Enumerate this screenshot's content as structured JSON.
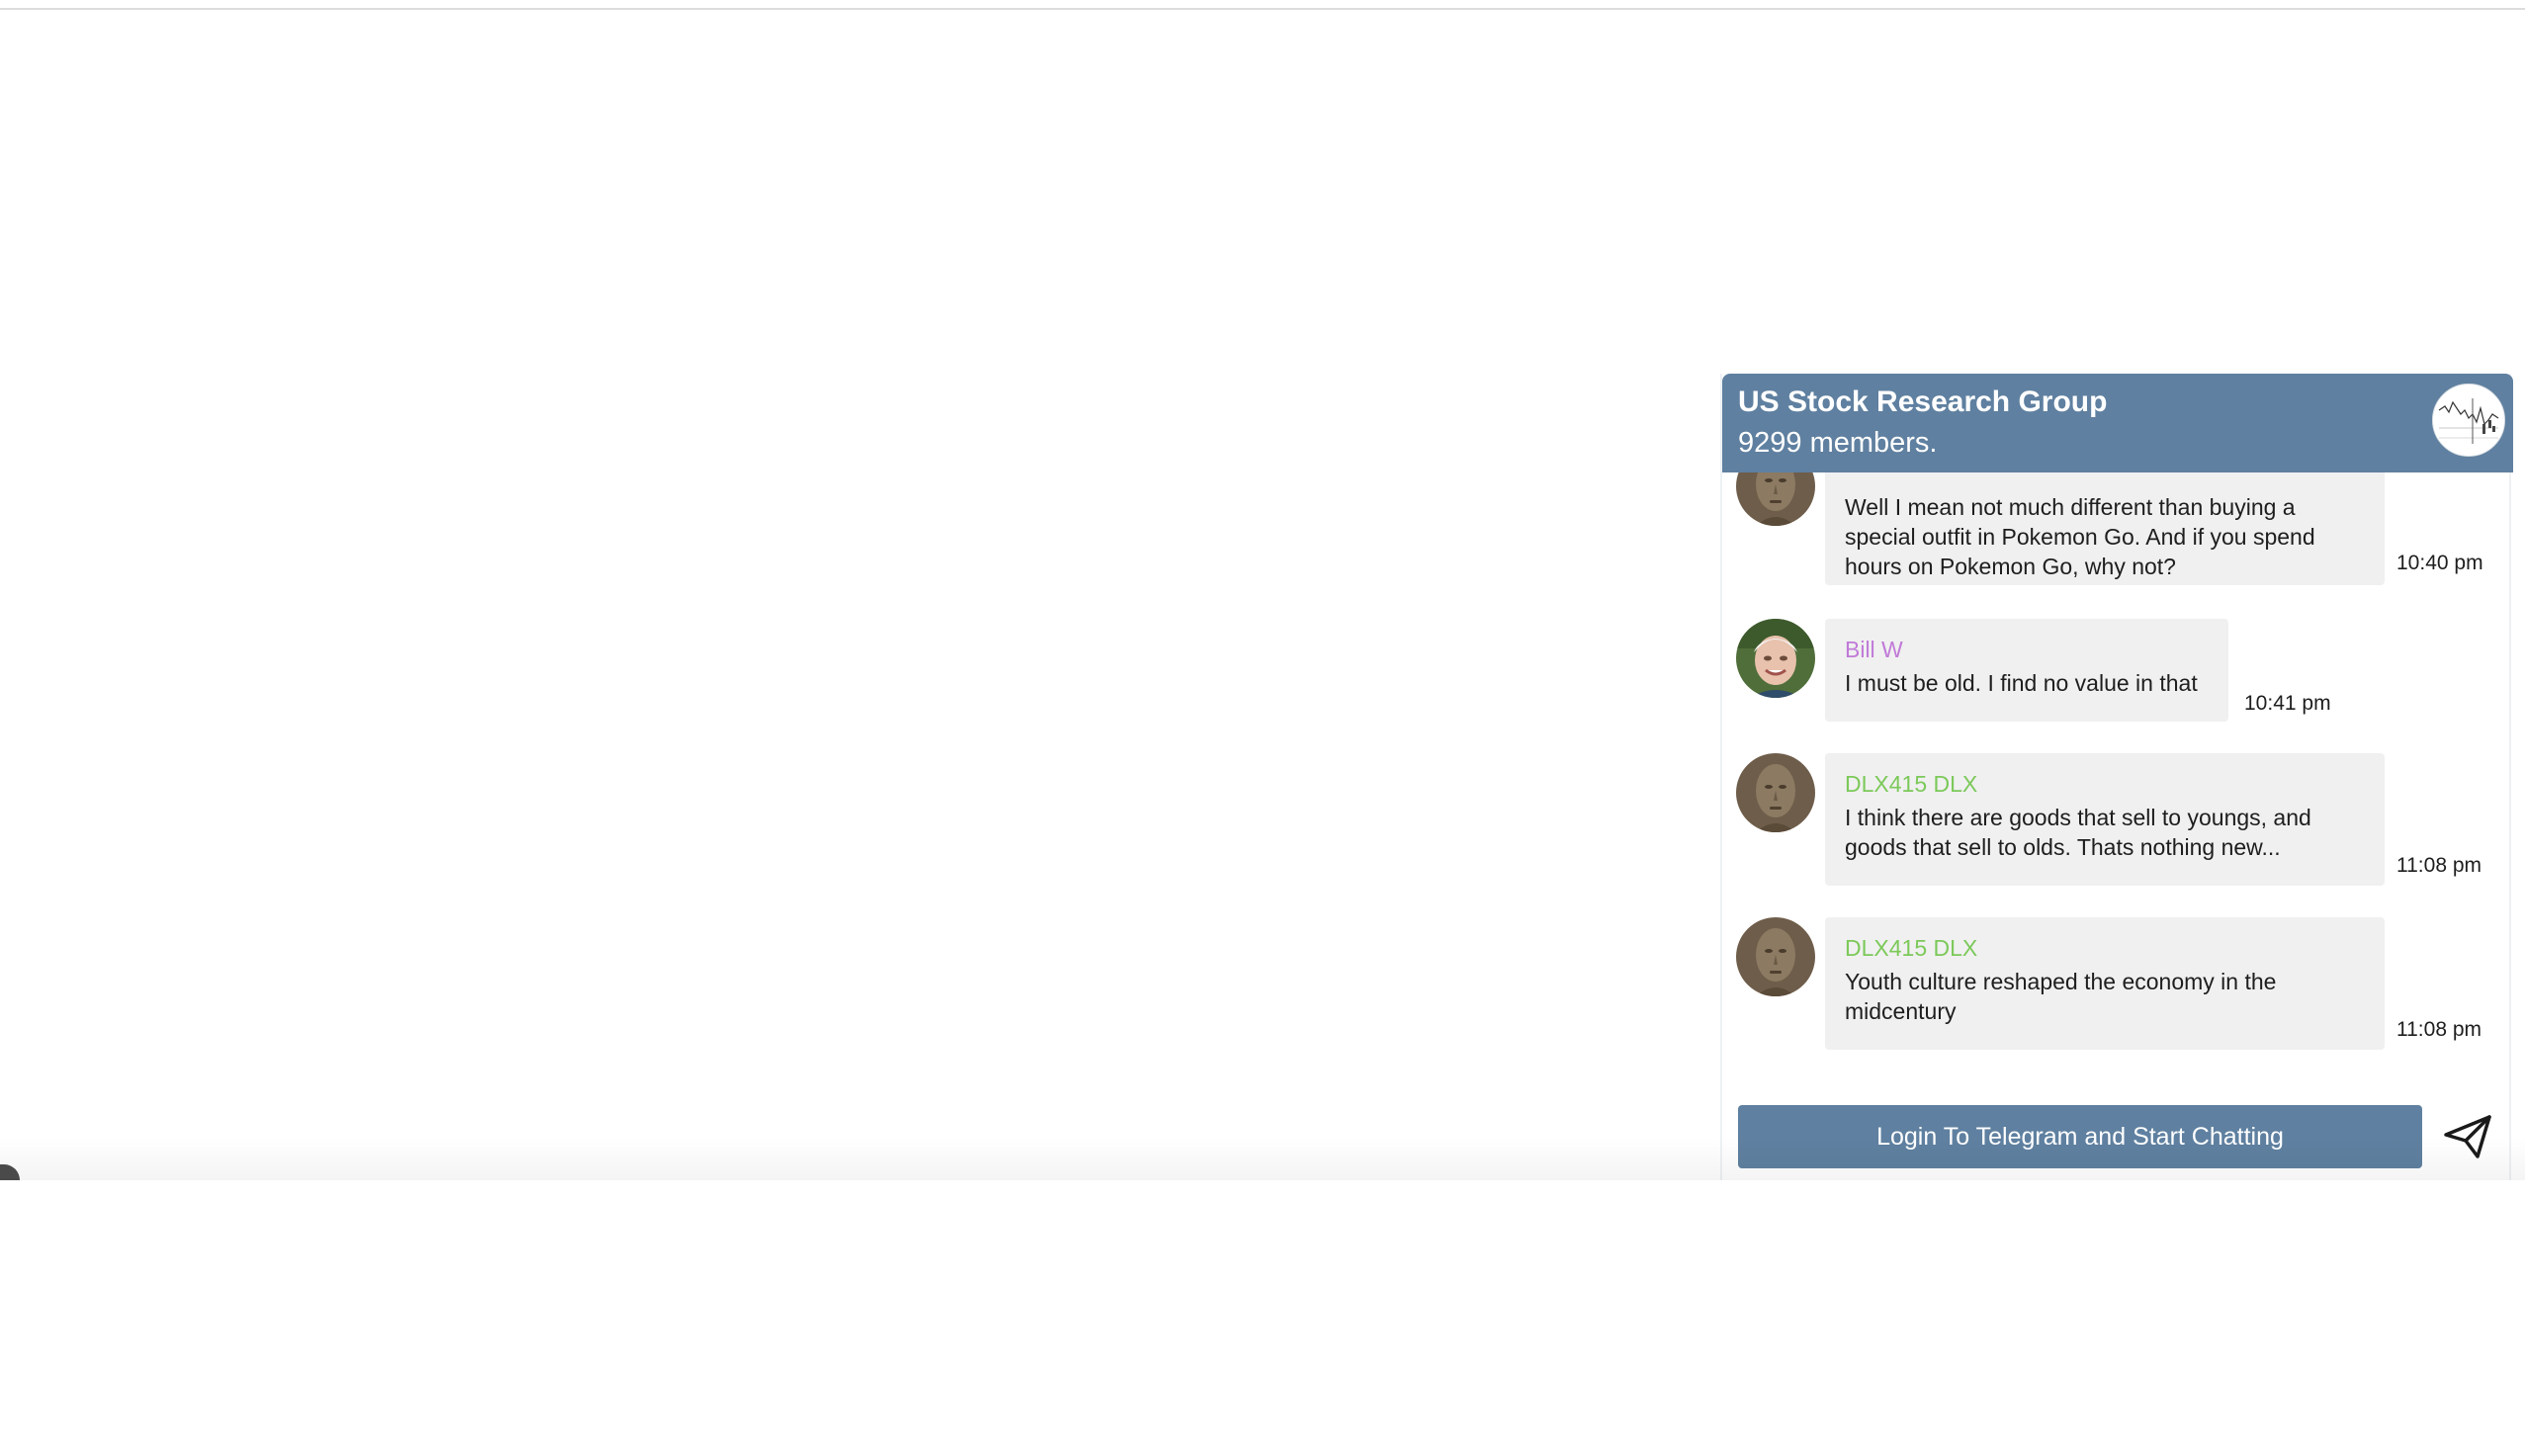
{
  "chat": {
    "title": "US Stock Research Group",
    "members": "9299 members.",
    "login_button": "Login To Telegram and Start Chatting",
    "send_icon": "send-icon",
    "group_avatar_icon": "stock-chart-avatar",
    "accent_color": "#5f80a0"
  },
  "messages": [
    {
      "sender": "",
      "sender_color": "#6cbf4f",
      "lines": [
        "Well I mean not much different than buying a",
        "special outfit in Pokemon Go. And if you spend",
        "hours on Pokemon Go, why not?"
      ],
      "time": "10:40 pm",
      "avatar": "statue-avatar"
    },
    {
      "sender": "Bill W",
      "sender_color": "#c07ad8",
      "lines": [
        "I must be old. I find no value in that"
      ],
      "time": "10:41 pm",
      "avatar": "elderly-man-avatar"
    },
    {
      "sender": "DLX415 DLX",
      "sender_color": "#7cc95a",
      "lines": [
        "I think there are goods that sell to youngs, and",
        "goods that sell to olds. Thats nothing new..."
      ],
      "time": "11:08 pm",
      "avatar": "statue-avatar"
    },
    {
      "sender": "DLX415 DLX",
      "sender_color": "#7cc95a",
      "lines": [
        "Youth culture reshaped the economy in the",
        "midcentury"
      ],
      "time": "11:08 pm",
      "avatar": "statue-avatar"
    }
  ]
}
